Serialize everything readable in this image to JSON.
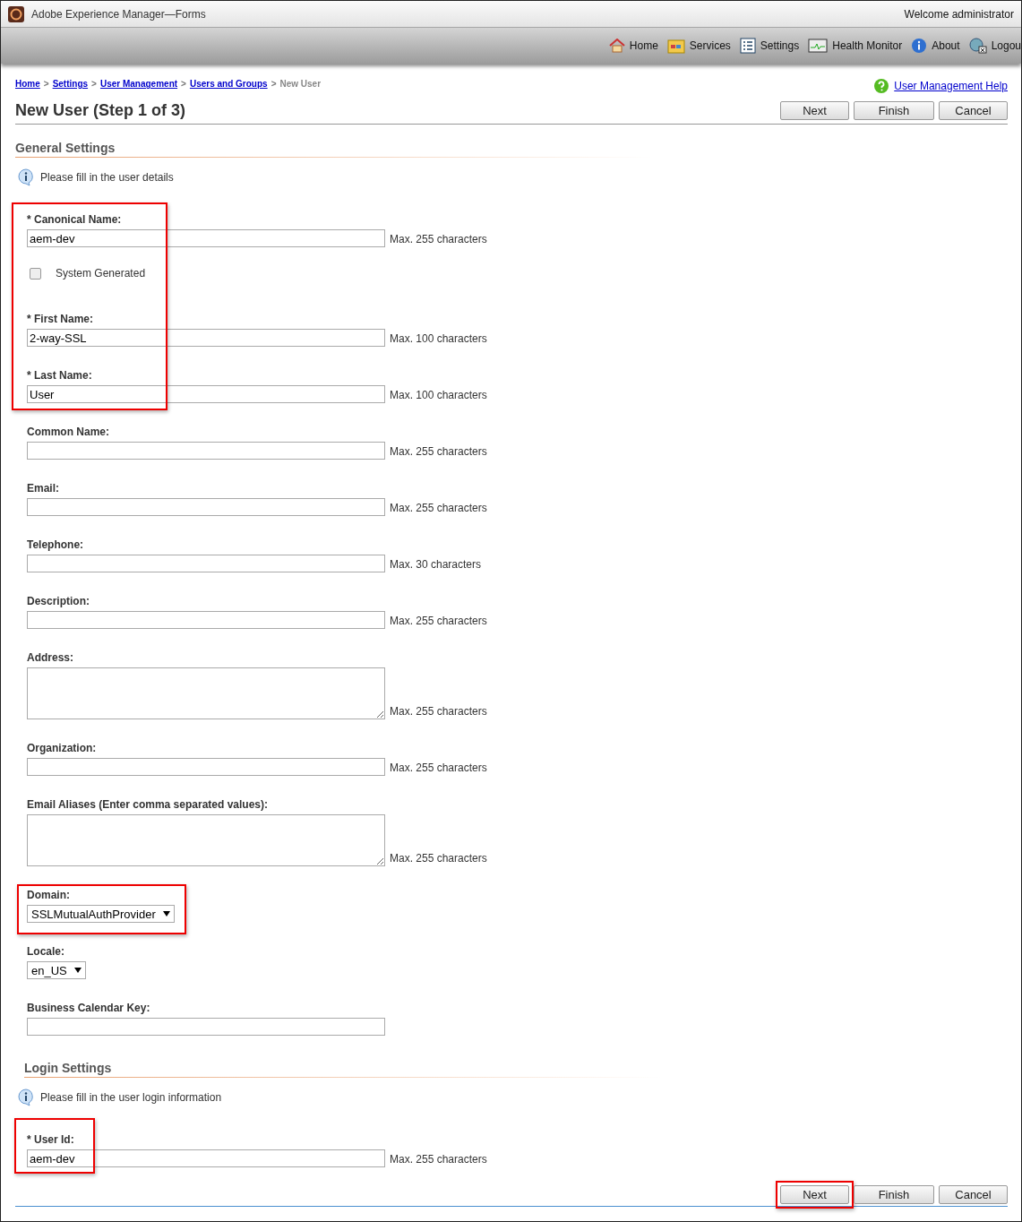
{
  "window": {
    "title": "Adobe Experience Manager—Forms",
    "welcome": "Welcome administrator"
  },
  "nav": [
    {
      "label": "Home",
      "kind": "home"
    },
    {
      "label": "Services",
      "kind": "services"
    },
    {
      "label": "Settings",
      "kind": "settings"
    },
    {
      "label": "Health Monitor",
      "kind": "monitor"
    },
    {
      "label": "About",
      "kind": "about"
    },
    {
      "label": "Logou",
      "kind": "logout"
    }
  ],
  "breadcrumb": [
    {
      "label": "Home",
      "link": true
    },
    {
      "label": ">",
      "kind": "separator"
    },
    {
      "label": "Settings",
      "link": true
    },
    {
      "label": ">",
      "kind": "separator"
    },
    {
      "label": "User Management",
      "link": true
    },
    {
      "label": ">",
      "kind": "separator"
    },
    {
      "label": "Users and Groups",
      "link": true
    },
    {
      "label": ">",
      "kind": "separator"
    },
    {
      "label": "New User",
      "link": false
    }
  ],
  "help_link": "User Management Help",
  "page_title": "New User (Step 1 of 3)",
  "top_buttons": [
    {
      "label": "Next",
      "highlighted": false
    },
    {
      "label": "Finish",
      "highlighted": false
    },
    {
      "label": "Cancel",
      "highlighted": false
    }
  ],
  "sections": [
    {
      "title": "General Settings",
      "info": "Please fill in the user details",
      "groups": [
        {
          "highlighted": true,
          "fields": [
            {
              "kind": "text",
              "label": "* Canonical Name:",
              "value": "aem-dev",
              "hint": "Max. 255 characters"
            },
            {
              "kind": "checkbox",
              "label": "System Generated",
              "checked": false
            },
            {
              "kind": "text",
              "label": "* First Name:",
              "value": "2-way-SSL",
              "hint": "Max. 100 characters"
            },
            {
              "kind": "text",
              "label": "* Last Name:",
              "value": "User",
              "hint": "Max. 100 characters"
            }
          ]
        },
        {
          "highlighted": false,
          "fields": [
            {
              "kind": "text",
              "label": "Common Name:",
              "hint": "Max. 255 characters"
            },
            {
              "kind": "text",
              "label": "Email:",
              "hint": "Max. 255 characters"
            },
            {
              "kind": "text",
              "label": "Telephone:",
              "hint": "Max. 30 characters"
            },
            {
              "kind": "text",
              "label": "Description:",
              "hint": "Max. 255 characters"
            },
            {
              "kind": "textarea",
              "label": "Address:",
              "hint": "Max. 255 characters"
            },
            {
              "kind": "text",
              "label": "Organization:",
              "hint": "Max. 255 characters"
            },
            {
              "kind": "textarea",
              "label": "Email Aliases (Enter comma separated values):",
              "hint": "Max. 255 characters"
            }
          ]
        },
        {
          "highlighted": true,
          "fields": [
            {
              "kind": "select",
              "label": "Domain:",
              "value": "SSLMutualAuthProvider"
            }
          ]
        },
        {
          "highlighted": false,
          "fields": [
            {
              "kind": "select",
              "label": "Locale:",
              "value": "en_US"
            },
            {
              "kind": "text",
              "label": "Business Calendar Key:"
            }
          ]
        }
      ]
    },
    {
      "title": "Login Settings",
      "info": "Please fill in the user login information",
      "groups": [
        {
          "highlighted": true,
          "fields": [
            {
              "kind": "text",
              "label": "* User Id:",
              "value": "aem-dev",
              "hint": "Max. 255 characters"
            }
          ]
        }
      ]
    }
  ],
  "bottom_buttons": [
    {
      "label": "Next",
      "highlighted": true
    },
    {
      "label": "Finish",
      "highlighted": false
    },
    {
      "label": "Cancel",
      "highlighted": false
    }
  ]
}
